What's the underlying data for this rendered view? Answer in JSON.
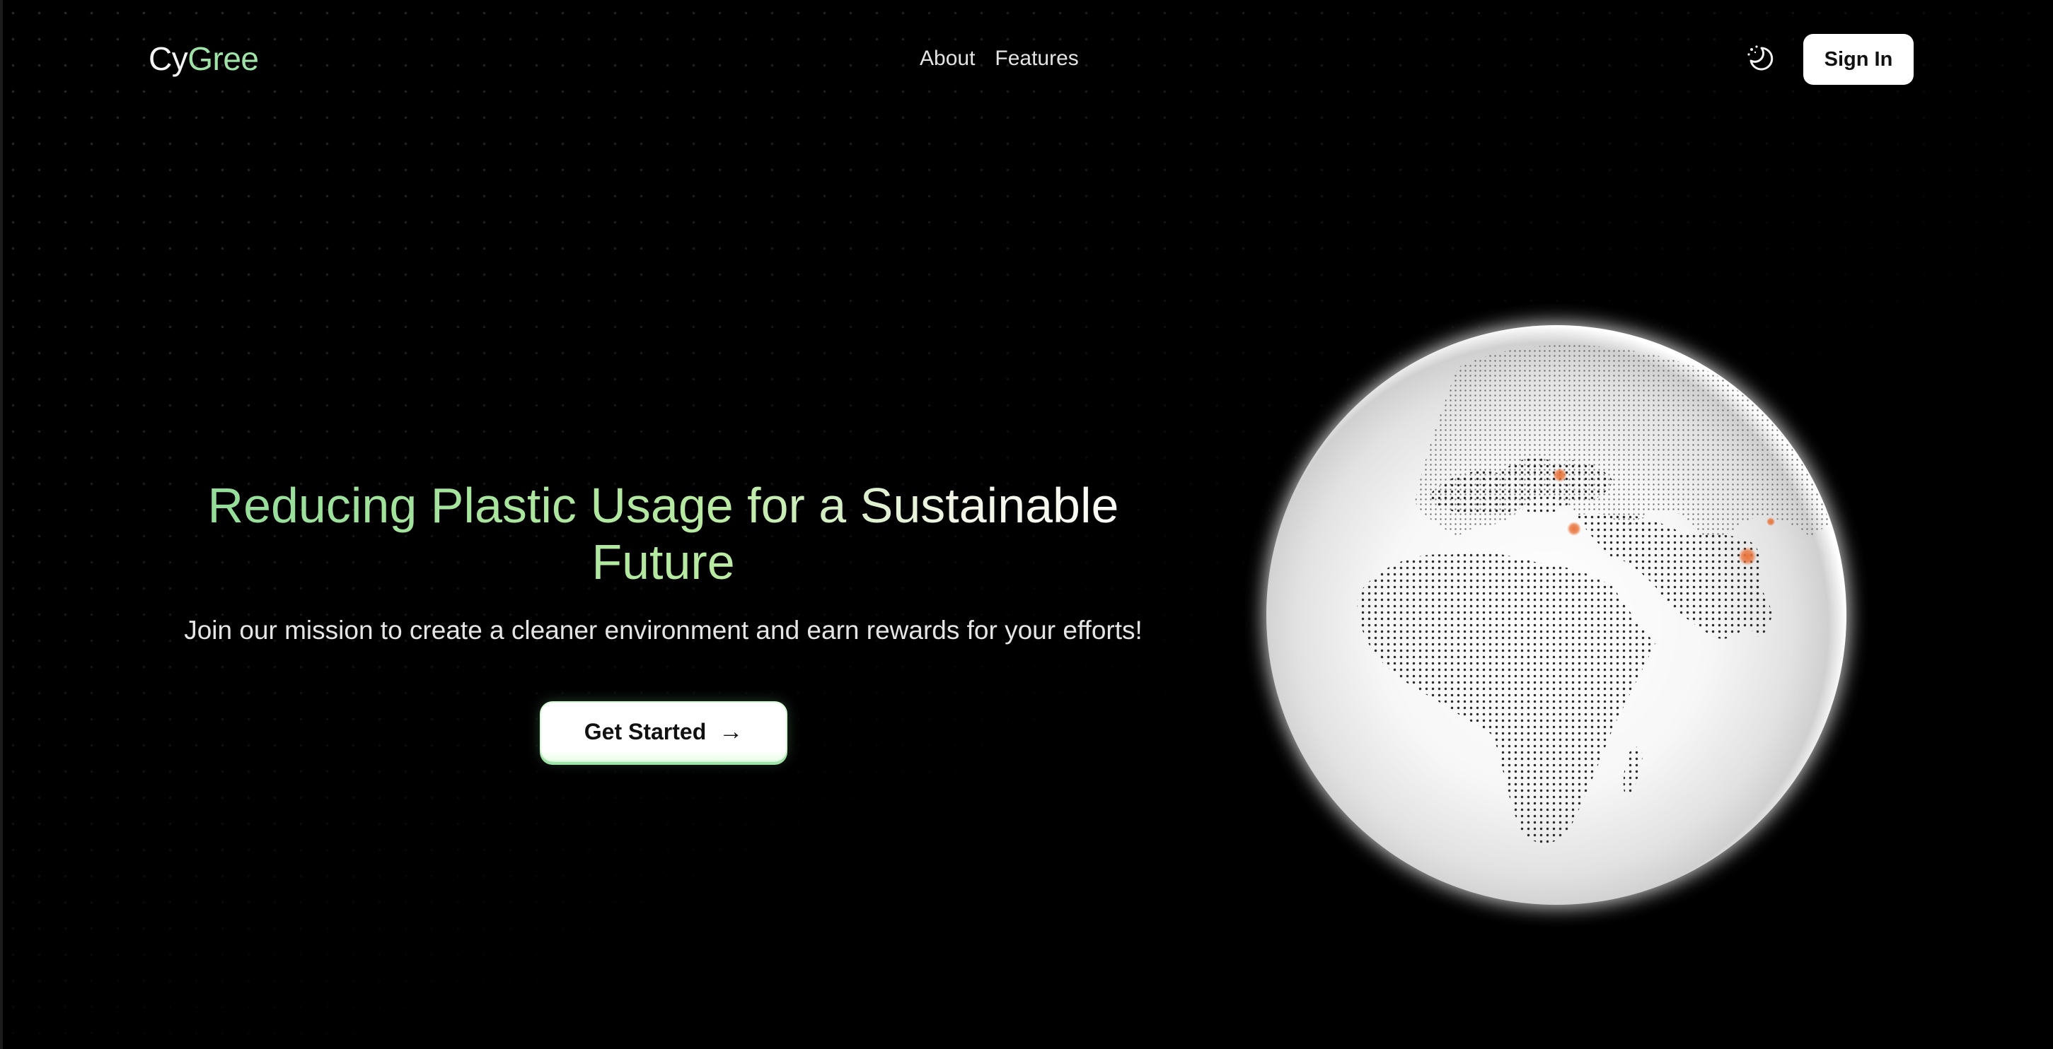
{
  "header": {
    "logo_prefix": "Cy",
    "logo_suffix": "Gree",
    "nav": [
      {
        "label": "About"
      },
      {
        "label": "Features"
      }
    ],
    "theme_toggle_icon": "moon-stars-icon",
    "signin_label": "Sign In"
  },
  "hero": {
    "title": "Reducing Plastic Usage for a Sustainable Future",
    "subtitle": "Join our mission to create a cleaner environment and earn rewards for your efforts!",
    "cta_label": "Get Started",
    "cta_icon": "→"
  },
  "globe": {
    "icon": "globe-icon",
    "marker_color": "#e8743b"
  },
  "colors": {
    "background": "#000000",
    "accent_green": "#9fe3a8",
    "text": "#e5e5e5",
    "button_bg": "#ffffff"
  }
}
